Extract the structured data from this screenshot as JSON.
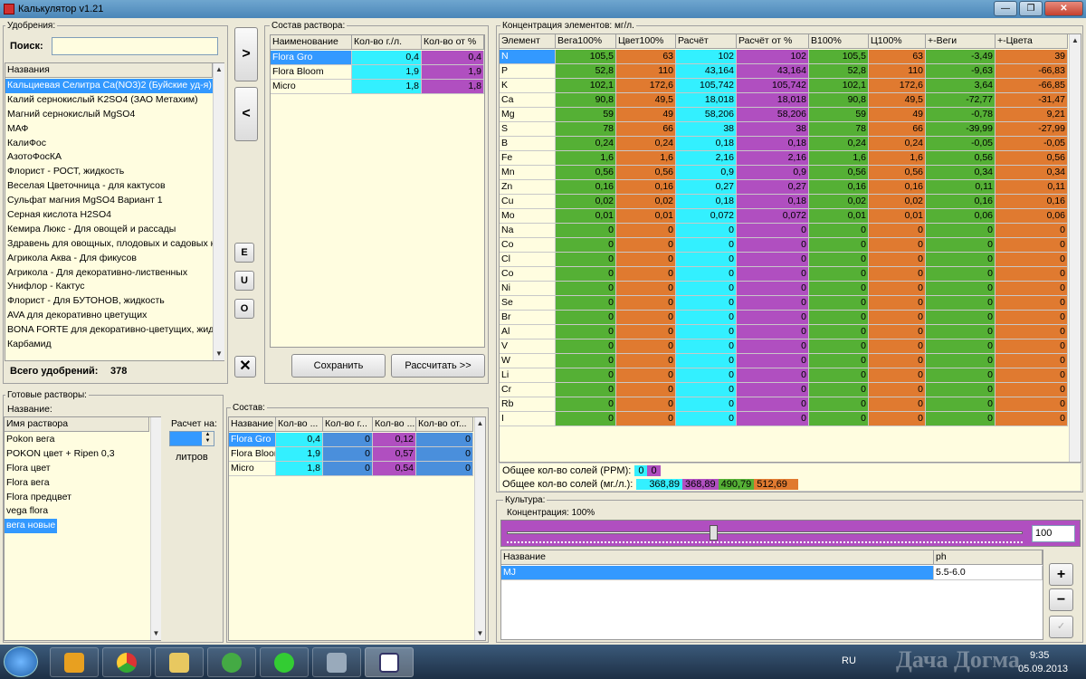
{
  "window": {
    "title": "Калькулятор v1.21",
    "btn_min": "—",
    "btn_max": "❐",
    "btn_close": "✕"
  },
  "fertilizers": {
    "group": "Удобрения:",
    "search_label": "Поиск:",
    "search_value": "",
    "column": "Названия",
    "items": [
      "Кальциевая Селитра Ca(NO3)2 (Буйские уд-я)",
      "Калий сернокислый K2SO4 (ЗАО Метахим)",
      "Магний сернокислый MgSO4",
      "МАФ",
      "КалиФос",
      "АзотоФосКА",
      "Флорист - РОСТ, жидкость",
      "Веселая Цветочница - для кактусов",
      "Сульфат магния MgSO4 Вариант 1",
      "Серная кислота H2SO4",
      "Кемира Люкс - Для овощей и рассады",
      "Здравень для овощных, плодовых и садовых к",
      "Агрикола Аква - Для фикусов",
      "Агрикола - Для декоративно-лиственных",
      "Унифлор - Кактус",
      "Флорист - Для БУТОНОВ, жидкость",
      "AVA для декоративно цветущих",
      "BONA FORTE для декоративно-цветущих, жид",
      "Карбамид"
    ],
    "total_label": "Всего удобрений:",
    "total": "378"
  },
  "mid_buttons": {
    "add": ">",
    "remove": "<",
    "e": "E",
    "u": "U",
    "o": "O",
    "clear": "✕"
  },
  "composition": {
    "group": "Состав раствора:",
    "headers": [
      "Наименование",
      "Кол-во г./л.",
      "Кол-во от %"
    ],
    "rows": [
      {
        "name": "Flora Gro",
        "g": "0,4",
        "p": "0,4"
      },
      {
        "name": "Flora Bloom",
        "g": "1,9",
        "p": "1,9"
      },
      {
        "name": "Micro",
        "g": "1,8",
        "p": "1,8"
      }
    ],
    "save": "Сохранить",
    "calc": "Рассчитать >>"
  },
  "concentration": {
    "group": "Концентрация элементов: мг/л.",
    "headers": [
      "Элемент",
      "Вега100%",
      "Цвет100%",
      "Расчёт",
      "Расчёт от %",
      "В100%",
      "Ц100%",
      "+-Веги",
      "+-Цвета"
    ],
    "rows": [
      [
        "N",
        "105,5",
        "63",
        "102",
        "102",
        "105,5",
        "63",
        "-3,49",
        "39"
      ],
      [
        "P",
        "52,8",
        "110",
        "43,164",
        "43,164",
        "52,8",
        "110",
        "-9,63",
        "-66,83"
      ],
      [
        "K",
        "102,1",
        "172,6",
        "105,742",
        "105,742",
        "102,1",
        "172,6",
        "3,64",
        "-66,85"
      ],
      [
        "Ca",
        "90,8",
        "49,5",
        "18,018",
        "18,018",
        "90,8",
        "49,5",
        "-72,77",
        "-31,47"
      ],
      [
        "Mg",
        "59",
        "49",
        "58,206",
        "58,206",
        "59",
        "49",
        "-0,78",
        "9,21"
      ],
      [
        "S",
        "78",
        "66",
        "38",
        "38",
        "78",
        "66",
        "-39,99",
        "-27,99"
      ],
      [
        "B",
        "0,24",
        "0,24",
        "0,18",
        "0,18",
        "0,24",
        "0,24",
        "-0,05",
        "-0,05"
      ],
      [
        "Fe",
        "1,6",
        "1,6",
        "2,16",
        "2,16",
        "1,6",
        "1,6",
        "0,56",
        "0,56"
      ],
      [
        "Mn",
        "0,56",
        "0,56",
        "0,9",
        "0,9",
        "0,56",
        "0,56",
        "0,34",
        "0,34"
      ],
      [
        "Zn",
        "0,16",
        "0,16",
        "0,27",
        "0,27",
        "0,16",
        "0,16",
        "0,11",
        "0,11"
      ],
      [
        "Cu",
        "0,02",
        "0,02",
        "0,18",
        "0,18",
        "0,02",
        "0,02",
        "0,16",
        "0,16"
      ],
      [
        "Mo",
        "0,01",
        "0,01",
        "0,072",
        "0,072",
        "0,01",
        "0,01",
        "0,06",
        "0,06"
      ],
      [
        "Na",
        "0",
        "0",
        "0",
        "0",
        "0",
        "0",
        "0",
        "0"
      ],
      [
        "Co",
        "0",
        "0",
        "0",
        "0",
        "0",
        "0",
        "0",
        "0"
      ],
      [
        "Cl",
        "0",
        "0",
        "0",
        "0",
        "0",
        "0",
        "0",
        "0"
      ],
      [
        "Co",
        "0",
        "0",
        "0",
        "0",
        "0",
        "0",
        "0",
        "0"
      ],
      [
        "Ni",
        "0",
        "0",
        "0",
        "0",
        "0",
        "0",
        "0",
        "0"
      ],
      [
        "Se",
        "0",
        "0",
        "0",
        "0",
        "0",
        "0",
        "0",
        "0"
      ],
      [
        "Br",
        "0",
        "0",
        "0",
        "0",
        "0",
        "0",
        "0",
        "0"
      ],
      [
        "Al",
        "0",
        "0",
        "0",
        "0",
        "0",
        "0",
        "0",
        "0"
      ],
      [
        "V",
        "0",
        "0",
        "0",
        "0",
        "0",
        "0",
        "0",
        "0"
      ],
      [
        "W",
        "0",
        "0",
        "0",
        "0",
        "0",
        "0",
        "0",
        "0"
      ],
      [
        "Li",
        "0",
        "0",
        "0",
        "0",
        "0",
        "0",
        "0",
        "0"
      ],
      [
        "Cr",
        "0",
        "0",
        "0",
        "0",
        "0",
        "0",
        "0",
        "0"
      ],
      [
        "Rb",
        "0",
        "0",
        "0",
        "0",
        "0",
        "0",
        "0",
        "0"
      ],
      [
        "I",
        "0",
        "0",
        "0",
        "0",
        "0",
        "0",
        "0",
        "0"
      ]
    ]
  },
  "totals": {
    "ppm_label": "Общее кол-во солей (PPM):",
    "ppm": [
      "0",
      "0"
    ],
    "mgl_label": "Общее кол-во солей (мг./л.):",
    "mgl": [
      "368,89",
      "368,89",
      "490,79",
      "512,69"
    ]
  },
  "ready": {
    "group": "Готовые растворы:",
    "name_label": "Название:",
    "column": "Имя раствора",
    "items": [
      "Pokon вега",
      "POKON цвет + Ripen 0,3",
      "Flora цвет",
      "Flora вега",
      "Flora предцвет",
      "vega flora",
      "вега новые"
    ],
    "calc_label": "Расчет на:",
    "liters": "литров"
  },
  "sostav": {
    "group": "Состав:",
    "headers": [
      "Название",
      "Кол-во ...",
      "Кол-во г...",
      "Кол-во ...",
      "Кол-во от..."
    ],
    "rows": [
      {
        "name": "Flora Gro",
        "a": "0,4",
        "b": "0",
        "c": "0,12",
        "d": "0"
      },
      {
        "name": "Flora Bloom",
        "a": "1,9",
        "b": "0",
        "c": "0,57",
        "d": "0"
      },
      {
        "name": "Micro",
        "a": "1,8",
        "b": "0",
        "c": "0,54",
        "d": "0"
      }
    ]
  },
  "culture": {
    "group": "Культура:",
    "conc_label": "Концентрация: 100%",
    "slider_value": 100,
    "value_text": "100",
    "headers": [
      "Название",
      "ph"
    ],
    "rows": [
      {
        "name": "MJ",
        "ph": "5.5-6.0"
      }
    ],
    "plus": "+",
    "minus": "−",
    "edit": "✓"
  },
  "taskbar": {
    "lang": "RU",
    "time": "9:35",
    "date": "05.09.2013",
    "watermark": "Дача Догма"
  },
  "colors": {
    "cyan": "#33f0ff",
    "magenta": "#b04fc0",
    "green": "#55b035",
    "orange": "#e07a30",
    "selection": "#3399ff"
  }
}
